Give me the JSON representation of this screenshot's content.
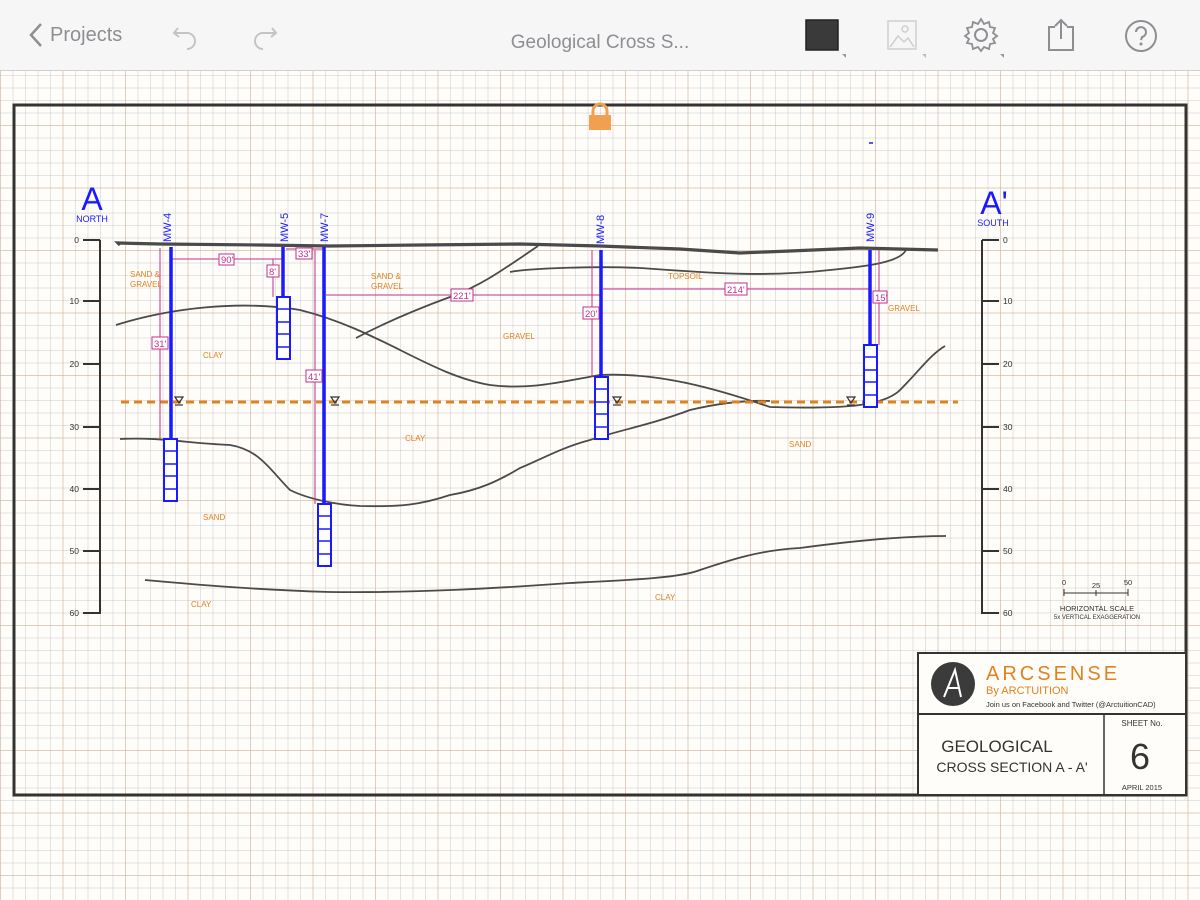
{
  "toolbar": {
    "back_label": "Projects",
    "title": "Geological Cross S...",
    "icons": [
      "chevron-left-icon",
      "undo-icon",
      "redo-icon",
      "color-swatch-icon",
      "image-icon",
      "gear-icon",
      "share-icon",
      "help-icon"
    ]
  },
  "section": {
    "left_letter": "A",
    "left_direction": "NORTH",
    "right_letter": "A'",
    "right_direction": "SOUTH",
    "depth_ticks": [
      "0",
      "10",
      "20",
      "30",
      "40",
      "50",
      "60"
    ]
  },
  "wells": [
    {
      "id": "mw4",
      "label": "MW-4"
    },
    {
      "id": "mw5",
      "label": "MW-5"
    },
    {
      "id": "mw7",
      "label": "MW-7"
    },
    {
      "id": "mw8",
      "label": "MW-8"
    },
    {
      "id": "mw9",
      "label": "MW-9"
    }
  ],
  "dimensions": {
    "d90": "90'",
    "d33": "33'",
    "d8": "8'",
    "d221": "221'",
    "d20": "20'",
    "d214": "214'",
    "d15": "15'",
    "d31": "31'",
    "d41": "41'"
  },
  "layers": {
    "sand_gravel_1": [
      "SAND &",
      "GRAVEL"
    ],
    "sand_gravel_2": [
      "SAND &",
      "GRAVEL"
    ],
    "topsoil": "TOPSOIL",
    "gravel_mid": "GRAVEL",
    "gravel_right": "GRAVEL",
    "clay_left": "CLAY",
    "clay_mid": "CLAY",
    "sand_right": "SAND",
    "sand_bottom": "SAND",
    "clay_bottom_left": "CLAY",
    "clay_bottom_mid": "CLAY"
  },
  "scale": {
    "ticks": [
      "0",
      "25",
      "50"
    ],
    "caption": "HORIZONTAL SCALE",
    "exaggeration": "5x VERTICAL EXAGGERATION"
  },
  "title_block": {
    "brand": "ARCSENSE",
    "byline": "By ARCTUITION",
    "social": "Join us on Facebook and Twitter (@ArctuitionCAD)",
    "title_line1": "GEOLOGICAL",
    "title_line2": "CROSS SECTION A - A'",
    "sheet_label": "SHEET No.",
    "sheet_number": "6",
    "date": "APRIL 2015"
  },
  "colors": {
    "well": "#1a1aff",
    "dimension": "#c0308a",
    "water_table": "#e0821e",
    "layer_label": "#e0821e",
    "strata": "#4a4a4a",
    "brand": "#e0821e",
    "lock": "#f0a050"
  }
}
